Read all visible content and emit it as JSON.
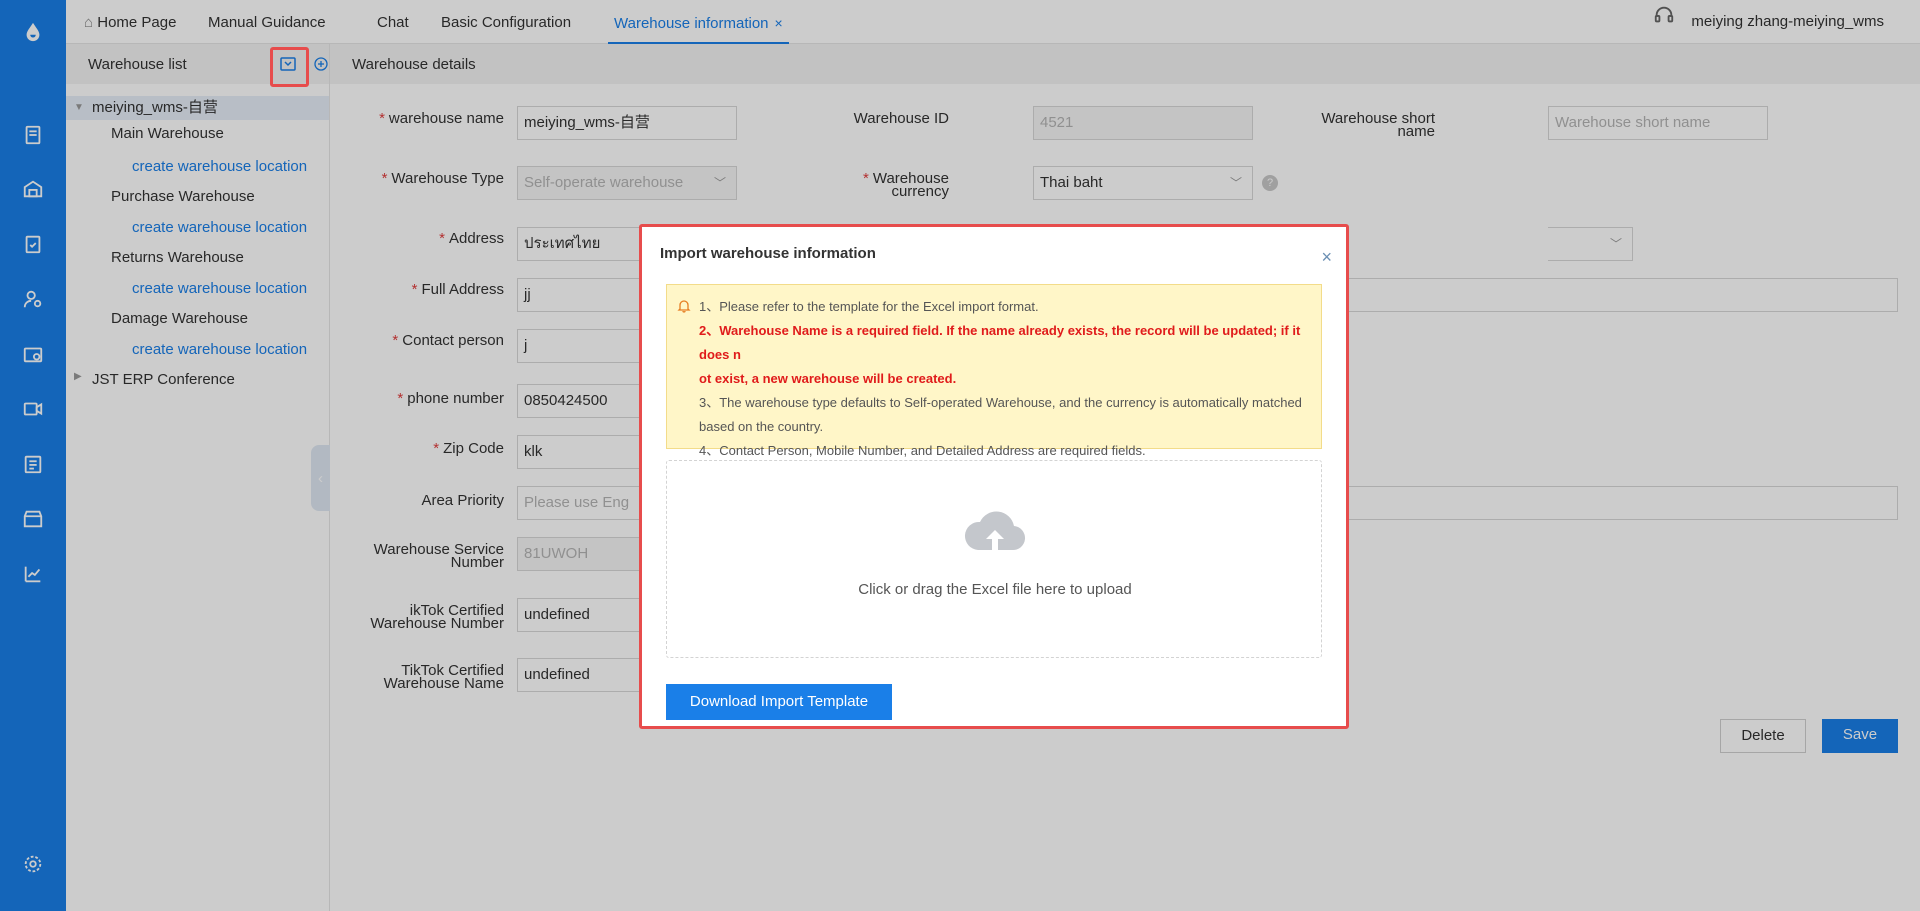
{
  "topbar": {
    "tabs": [
      {
        "label": "Home Page",
        "icon": "home-icon"
      },
      {
        "label": "Manual Guidance"
      },
      {
        "label": "Chat"
      },
      {
        "label": "Basic Configuration"
      },
      {
        "label": "Warehouse information",
        "close": "×",
        "active": true
      }
    ],
    "user": "meiying zhang-meiying_wms"
  },
  "sidebar": {
    "title": "Warehouse list",
    "tree": {
      "root": "meiying_wms-自营",
      "children": [
        {
          "label": "Main Warehouse",
          "link": "create warehouse location"
        },
        {
          "label": "Purchase Warehouse",
          "link": "create warehouse location"
        },
        {
          "label": "Returns Warehouse",
          "link": "create warehouse location"
        },
        {
          "label": "Damage Warehouse",
          "link": "create warehouse location"
        }
      ],
      "second_root": "JST ERP Conference"
    }
  },
  "main": {
    "title": "Warehouse details",
    "fields": {
      "warehouse_name": {
        "label": "warehouse name",
        "value": "meiying_wms-自营"
      },
      "warehouse_id": {
        "label": "Warehouse ID",
        "value": "4521"
      },
      "short_name": {
        "label_1": "Warehouse short",
        "label_2": "name",
        "placeholder": "Warehouse short name"
      },
      "warehouse_type": {
        "label": "Warehouse Type",
        "value": "Self-operate warehouse"
      },
      "currency": {
        "label_1": "Warehouse",
        "label_2": "currency",
        "value": "Thai baht"
      },
      "address": {
        "label": "Address",
        "value": "ประเทศไทย"
      },
      "full_address": {
        "label": "Full Address",
        "value": "jj"
      },
      "contact_person": {
        "label": "Contact person",
        "value": "j"
      },
      "phone": {
        "label": "phone number",
        "value": "0850424500"
      },
      "zip": {
        "label": "Zip Code",
        "value": "klk"
      },
      "area_priority": {
        "label": "Area Priority",
        "placeholder": "Please use  Eng"
      },
      "service_number": {
        "label_1": "Warehouse Service",
        "label_2": "Number",
        "value": "81UWOH"
      },
      "tiktok_number": {
        "label_1": "ikTok Certified",
        "label_2": "Warehouse Number",
        "value": "undefined"
      },
      "tiktok_name": {
        "label_1": "TikTok Certified",
        "label_2": "Warehouse Name",
        "value": "undefined"
      }
    },
    "delete_label": "Delete",
    "save_label": "Save"
  },
  "modal": {
    "title": "Import warehouse information",
    "close": "×",
    "notice": [
      "1、Please refer to the template for the Excel import format.",
      "2、Warehouse Name is a required field. If the name already exists, the record will be updated; if it does n",
      "ot exist, a new warehouse will be created.",
      "3、The warehouse type defaults to Self-operated Warehouse, and the currency is automatically matched",
      "based on the country.",
      "4、Contact Person, Mobile Number, and Detailed Address are required fields."
    ],
    "upload_text": "Click or drag the Excel file here to upload",
    "download_label": "Download Import Template"
  },
  "colors": {
    "primary": "#1a7fe8",
    "highlight": "#e74c4c",
    "notice_bg": "#fff6c8",
    "required": "#e03c3c"
  }
}
